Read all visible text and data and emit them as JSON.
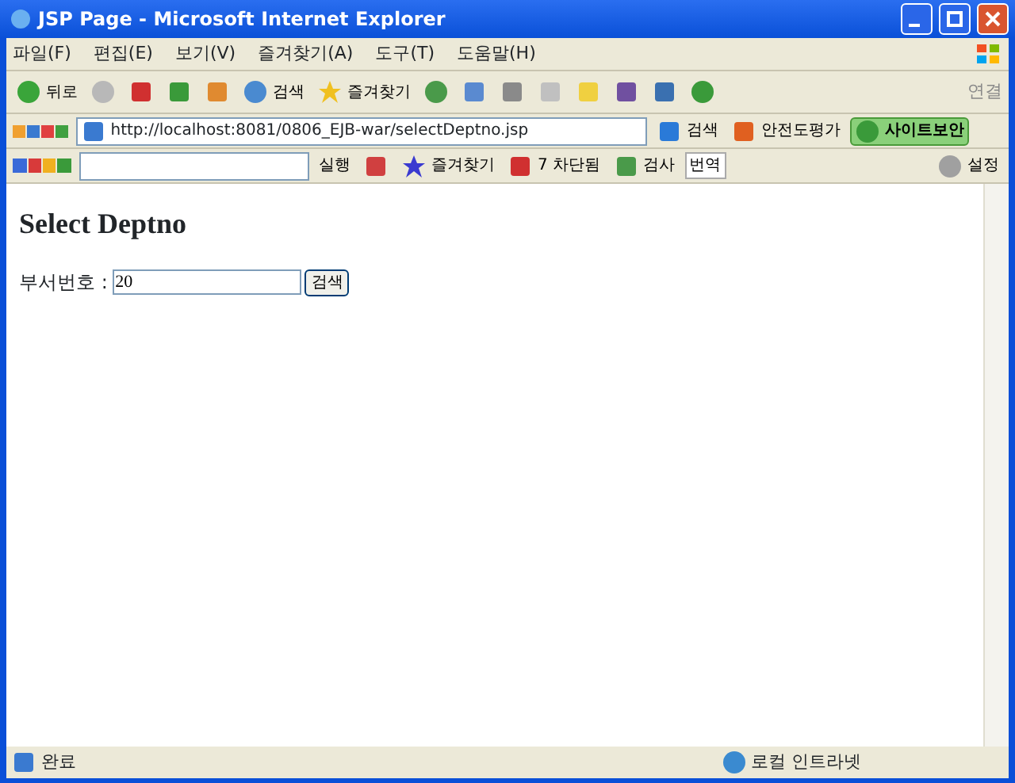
{
  "window": {
    "title": "JSP Page - Microsoft Internet Explorer"
  },
  "menu": [
    "파일(F)",
    "편집(E)",
    "보기(V)",
    "즐겨찾기(A)",
    "도구(T)",
    "도움말(H)"
  ],
  "toolbar": {
    "back": "뒤로",
    "search": "검색",
    "favorites": "즐겨찾기",
    "links": "연결"
  },
  "address_bar": {
    "url": "http://localhost:8081/0806_EJB-war/selectDeptno.jsp",
    "search": "검색",
    "rating": "안전도평가",
    "security": "사이트보안"
  },
  "google_bar": {
    "run": "실행",
    "favorites": "즐겨찾기",
    "blocked": "7 차단됨",
    "check": "검사",
    "translate": "번역",
    "settings": "설정"
  },
  "page": {
    "heading": "Select Deptno",
    "label": "부서번호 :",
    "value": "20",
    "button": "검색"
  },
  "status_bar": {
    "text": "완료",
    "zone": "로컬 인트라넷"
  }
}
